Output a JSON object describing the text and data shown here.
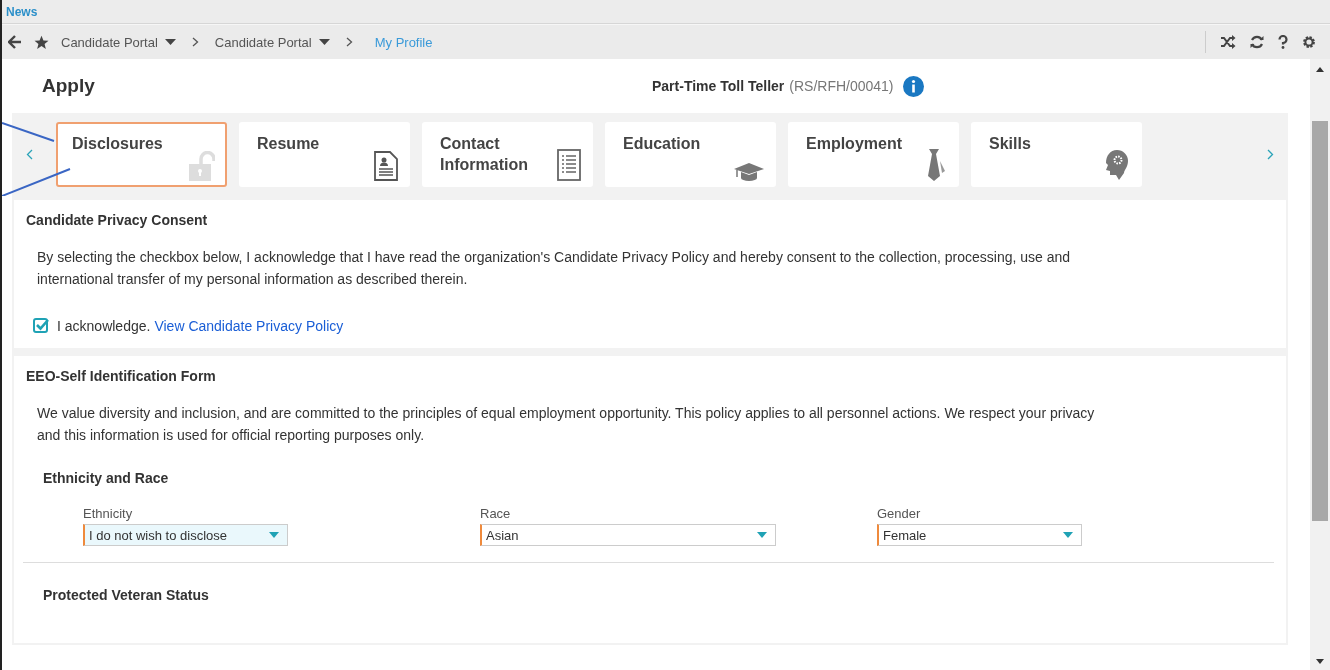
{
  "top_bar": {
    "tab": "News"
  },
  "nav": {
    "breadcrumbs": [
      {
        "label": "Candidate Portal",
        "dropdown": true,
        "link": false
      },
      {
        "label": "Candidate Portal",
        "dropdown": true,
        "link": false
      },
      {
        "label": "My Profile",
        "dropdown": false,
        "link": true
      }
    ]
  },
  "header": {
    "title": "Apply",
    "job_title": "Part-Time Toll Teller",
    "job_code": "(RS/RFH/00041)"
  },
  "steps": [
    {
      "label": "Disclosures",
      "kind": "lock",
      "selected": true
    },
    {
      "label": "Resume",
      "kind": "resume",
      "selected": false
    },
    {
      "label": "Contact Information",
      "kind": "list",
      "selected": false
    },
    {
      "label": "Education",
      "kind": "cap",
      "selected": false
    },
    {
      "label": "Employment",
      "kind": "tie",
      "selected": false
    },
    {
      "label": "Skills",
      "kind": "head",
      "selected": false
    }
  ],
  "privacy": {
    "title": "Candidate Privacy Consent",
    "text": "By selecting the checkbox below, I acknowledge that I have read the organization's Candidate Privacy Policy and hereby consent to the collection, processing, use and international transfer of my personal information as described therein.",
    "checkbox": {
      "checked": true,
      "label": "I acknowledge.",
      "link": "View Candidate Privacy Policy"
    }
  },
  "eeo": {
    "title": "EEO-Self Identification Form",
    "text": "We value diversity and inclusion, and are committed to the principles of equal employment opportunity. This policy applies to all personnel actions. We respect your privacy and this information is used for official reporting purposes only.",
    "subsections": [
      {
        "title": "Ethnicity and Race",
        "fields": [
          {
            "label": "Ethnicity",
            "value": "I do not wish to disclose",
            "focused": true
          },
          {
            "label": "Race",
            "value": "Asian",
            "focused": false
          },
          {
            "label": "Gender",
            "value": "Female",
            "focused": false
          }
        ]
      },
      {
        "title": "Protected Veteran Status"
      }
    ]
  }
}
